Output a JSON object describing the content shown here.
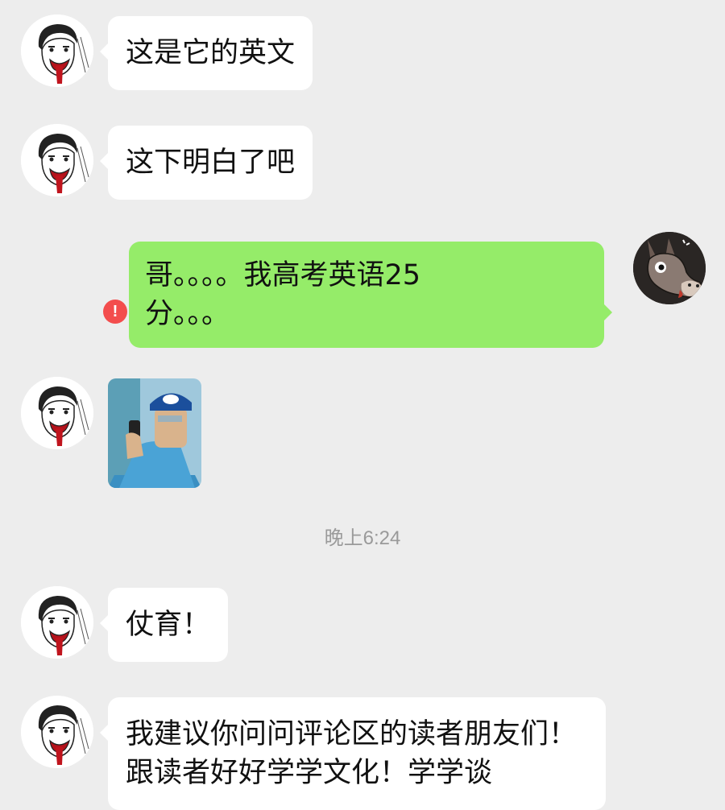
{
  "messages": [
    {
      "sender": "them",
      "text": "这是它的英文"
    },
    {
      "sender": "them",
      "text": "这下明白了吧"
    },
    {
      "sender": "me",
      "text": "哥。。。。我高考英语25分。。。",
      "status": "failed"
    },
    {
      "sender": "them",
      "type": "sticker",
      "sticker_icon": "man-on-phone-sticker"
    },
    {
      "type": "timestamp",
      "text": "晚上6:24"
    },
    {
      "sender": "them",
      "text": "仗育！"
    },
    {
      "sender": "them",
      "text": "我建议你问问评论区的读者朋友们！跟读者好好学学文化！学学谈"
    }
  ],
  "colors": {
    "background": "#ededed",
    "incoming_bubble": "#ffffff",
    "outgoing_bubble": "#95ec69",
    "error": "#f34d4d",
    "timestamp": "#9a9a9a"
  },
  "icons": {
    "their_avatar": "sketch-face-avatar",
    "my_avatar": "donkey-avatar",
    "error": "exclamation-icon"
  }
}
